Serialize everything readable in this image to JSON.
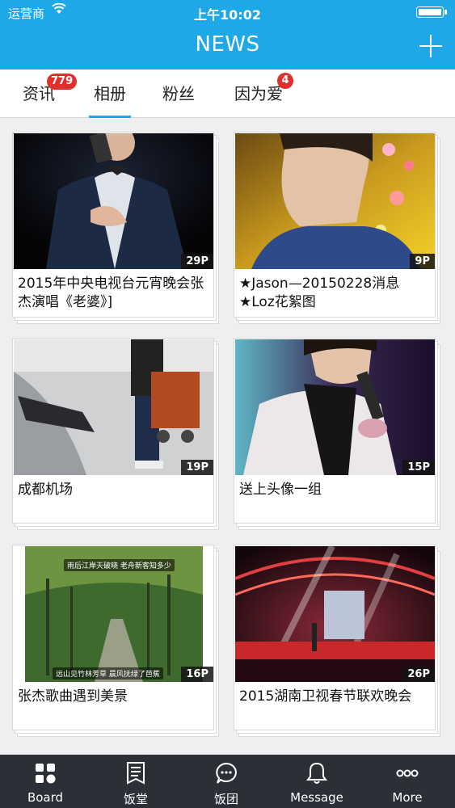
{
  "status": {
    "carrier": "运营商",
    "time": "上午10:02"
  },
  "nav": {
    "title": "NEWS"
  },
  "tabs": [
    {
      "label": "资讯",
      "badge": "779"
    },
    {
      "label": "相册",
      "badge": ""
    },
    {
      "label": "粉丝",
      "badge": ""
    },
    {
      "label": "因为爱",
      "badge": "4"
    }
  ],
  "albums": [
    {
      "count": "29P",
      "caption": "2015年中央电视台元宵晚会张杰演唱《老婆》]"
    },
    {
      "count": "9P",
      "caption": "★Jason—20150228消息★Loz花絮图"
    },
    {
      "count": "19P",
      "caption": "成都机场"
    },
    {
      "count": "15P",
      "caption": "送上头像一组"
    },
    {
      "count": "16P",
      "caption": "张杰歌曲遇到美景"
    },
    {
      "count": "26P",
      "caption": "2015湖南卫视春节联欢晚会"
    }
  ],
  "photo_texts": {
    "top": "雨后江岸天破晓 老舟新客知多少",
    "bottom": "远山见竹林芳草 晨风抚绿了芭蕉"
  },
  "bottom_bar": [
    {
      "label": "Board",
      "icon": "board-icon"
    },
    {
      "label": "饭堂",
      "icon": "document-icon"
    },
    {
      "label": "饭团",
      "icon": "chat-bubble-icon"
    },
    {
      "label": "Message",
      "icon": "bell-icon"
    },
    {
      "label": "More",
      "icon": "more-icon"
    }
  ]
}
